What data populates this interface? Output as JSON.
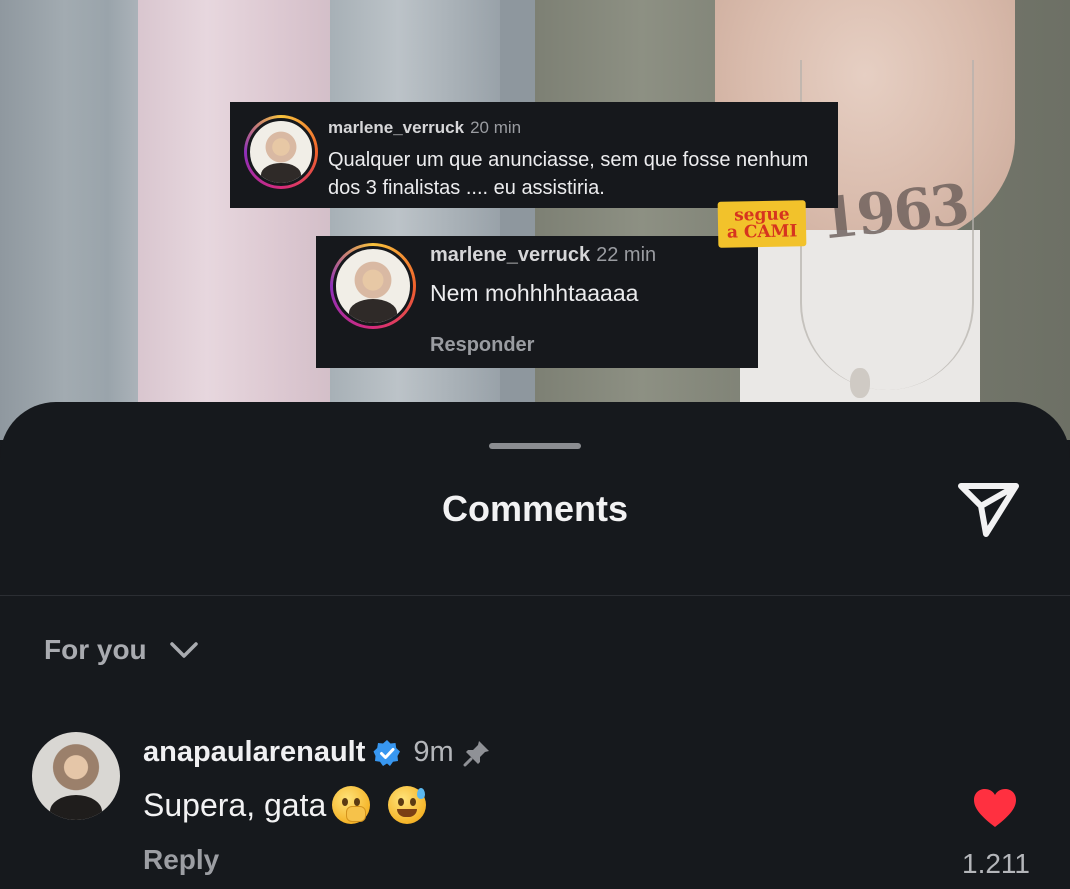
{
  "overlay_comments": [
    {
      "username": "marlene_verruck",
      "time": "20 min",
      "text": "Qualquer um que anunciasse, sem que fosse nenhum dos 3 finalistas .... eu assistiria."
    },
    {
      "username": "marlene_verruck",
      "time": "22 min",
      "text": "Nem mohhhhtaaaaa",
      "reply_label": "Responder"
    }
  ],
  "sticker": {
    "line1": "segue",
    "line2": "a CAMI"
  },
  "tattoo_text": "1963",
  "sheet": {
    "title": "Comments",
    "filter_label": "For you"
  },
  "comment": {
    "username": "anapaularenault",
    "time": "9m",
    "text": "Supera, gata",
    "reply_label": "Reply",
    "likes": "1.211",
    "verified": true,
    "pinned": true
  },
  "colors": {
    "sheet_bg": "#16191d",
    "verified": "#3897f0",
    "heart": "#ff3040"
  },
  "icons": [
    "send-icon",
    "chevron-down-icon",
    "verified-badge-icon",
    "pin-icon",
    "heart-icon"
  ]
}
